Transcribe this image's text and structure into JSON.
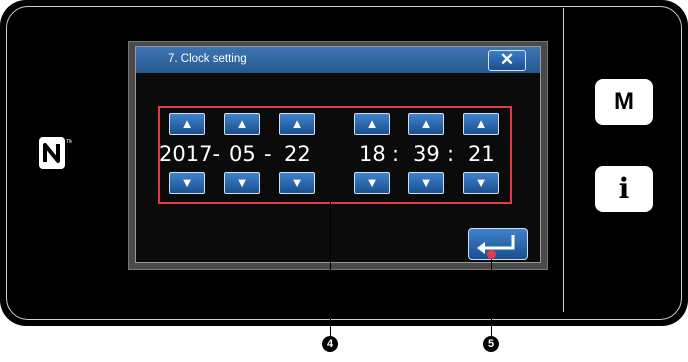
{
  "dialog": {
    "title": "7. Clock setting",
    "close_symbol": "✕"
  },
  "clock": {
    "year": "2017-",
    "month": "05",
    "sep_date": "-",
    "day": "22",
    "hour": "18",
    "sep_time1": ":",
    "minute": "39",
    "sep_time2": ":",
    "second": "21",
    "up_symbol": "▲",
    "down_symbol": "▼"
  },
  "side_panel": {
    "m_label": "M",
    "info_label": "i"
  },
  "callouts": {
    "frame_number": "4",
    "enter_number": "5"
  },
  "colors": {
    "frame": "#e03b4a",
    "button": "#2a66ad",
    "title_bar": "#3068a6"
  },
  "icons": [
    "close-icon",
    "up-arrow-icon",
    "down-arrow-icon",
    "enter-icon",
    "nfc-icon",
    "info-icon"
  ]
}
